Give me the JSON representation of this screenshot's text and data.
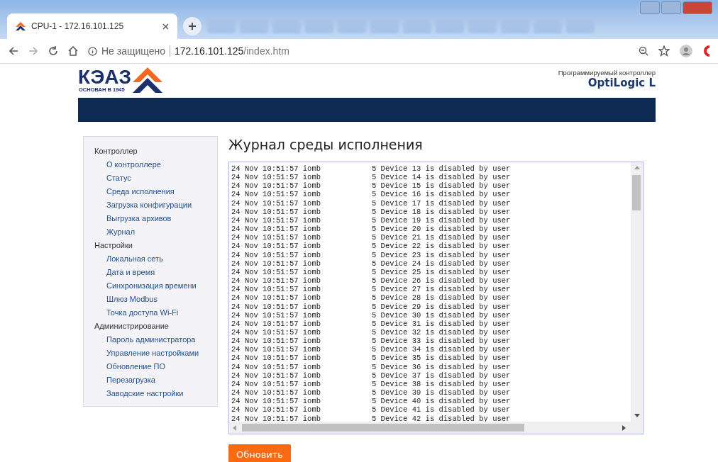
{
  "browser": {
    "tab_title": "CPU-1 - 172.16.101.125",
    "security": "Не защищено",
    "address_host": "172.16.101.125",
    "address_path": "/index.htm"
  },
  "header": {
    "logo": "КЭАЗ",
    "tagline": "ОСНОВАН В 1945",
    "subtitle": "Программируемый контроллер",
    "product": "OptiLogic L"
  },
  "sidebar": {
    "sections": [
      {
        "title": "Контроллер",
        "items": [
          "О контроллере",
          "Статус",
          "Среда исполнения",
          "Загрузка конфигурации",
          "Выгрузка архивов",
          "Журнал"
        ]
      },
      {
        "title": "Настройки",
        "items": [
          "Локальная сеть",
          "Дата и время",
          "Синхронизация времени",
          "Шлюз Modbus",
          "Точка доступа Wi-Fi"
        ]
      },
      {
        "title": "Администрирование",
        "items": [
          "Пароль администратора",
          "Управление настройками",
          "Обновление ПО",
          "Перезагрузка",
          "Заводские настройки"
        ]
      }
    ]
  },
  "page_title": "Журнал среды исполнения",
  "log": [
    {
      "source": "24 Nov 10:51:57 iomb",
      "message": "5 Device 13 is disabled by user"
    },
    {
      "source": "24 Nov 10:51:57 iomb",
      "message": "5 Device 14 is disabled by user"
    },
    {
      "source": "24 Nov 10:51:57 iomb",
      "message": "5 Device 15 is disabled by user"
    },
    {
      "source": "24 Nov 10:51:57 iomb",
      "message": "5 Device 16 is disabled by user"
    },
    {
      "source": "24 Nov 10:51:57 iomb",
      "message": "5 Device 17 is disabled by user"
    },
    {
      "source": "24 Nov 10:51:57 iomb",
      "message": "5 Device 18 is disabled by user"
    },
    {
      "source": "24 Nov 10:51:57 iomb",
      "message": "5 Device 19 is disabled by user"
    },
    {
      "source": "24 Nov 10:51:57 iomb",
      "message": "5 Device 20 is disabled by user"
    },
    {
      "source": "24 Nov 10:51:57 iomb",
      "message": "5 Device 21 is disabled by user"
    },
    {
      "source": "24 Nov 10:51:57 iomb",
      "message": "5 Device 22 is disabled by user"
    },
    {
      "source": "24 Nov 10:51:57 iomb",
      "message": "5 Device 23 is disabled by user"
    },
    {
      "source": "24 Nov 10:51:57 iomb",
      "message": "5 Device 24 is disabled by user"
    },
    {
      "source": "24 Nov 10:51:57 iomb",
      "message": "5 Device 25 is disabled by user"
    },
    {
      "source": "24 Nov 10:51:57 iomb",
      "message": "5 Device 26 is disabled by user"
    },
    {
      "source": "24 Nov 10:51:57 iomb",
      "message": "5 Device 27 is disabled by user"
    },
    {
      "source": "24 Nov 10:51:57 iomb",
      "message": "5 Device 28 is disabled by user"
    },
    {
      "source": "24 Nov 10:51:57 iomb",
      "message": "5 Device 29 is disabled by user"
    },
    {
      "source": "24 Nov 10:51:57 iomb",
      "message": "5 Device 30 is disabled by user"
    },
    {
      "source": "24 Nov 10:51:57 iomb",
      "message": "5 Device 31 is disabled by user"
    },
    {
      "source": "24 Nov 10:51:57 iomb",
      "message": "5 Device 32 is disabled by user"
    },
    {
      "source": "24 Nov 10:51:57 iomb",
      "message": "5 Device 33 is disabled by user"
    },
    {
      "source": "24 Nov 10:51:57 iomb",
      "message": "5 Device 34 is disabled by user"
    },
    {
      "source": "24 Nov 10:51:57 iomb",
      "message": "5 Device 35 is disabled by user"
    },
    {
      "source": "24 Nov 10:51:57 iomb",
      "message": "5 Device 36 is disabled by user"
    },
    {
      "source": "24 Nov 10:51:57 iomb",
      "message": "5 Device 37 is disabled by user"
    },
    {
      "source": "24 Nov 10:51:57 iomb",
      "message": "5 Device 38 is disabled by user"
    },
    {
      "source": "24 Nov 10:51:57 iomb",
      "message": "5 Device 39 is disabled by user"
    },
    {
      "source": "24 Nov 10:51:57 iomb",
      "message": "5 Device 40 is disabled by user"
    },
    {
      "source": "24 Nov 10:51:57 iomb",
      "message": "5 Device 41 is disabled by user"
    },
    {
      "source": "24 Nov 10:51:57 iomb",
      "message": "5 Device 42 is disabled by user"
    }
  ],
  "refresh_button": "Обновить"
}
